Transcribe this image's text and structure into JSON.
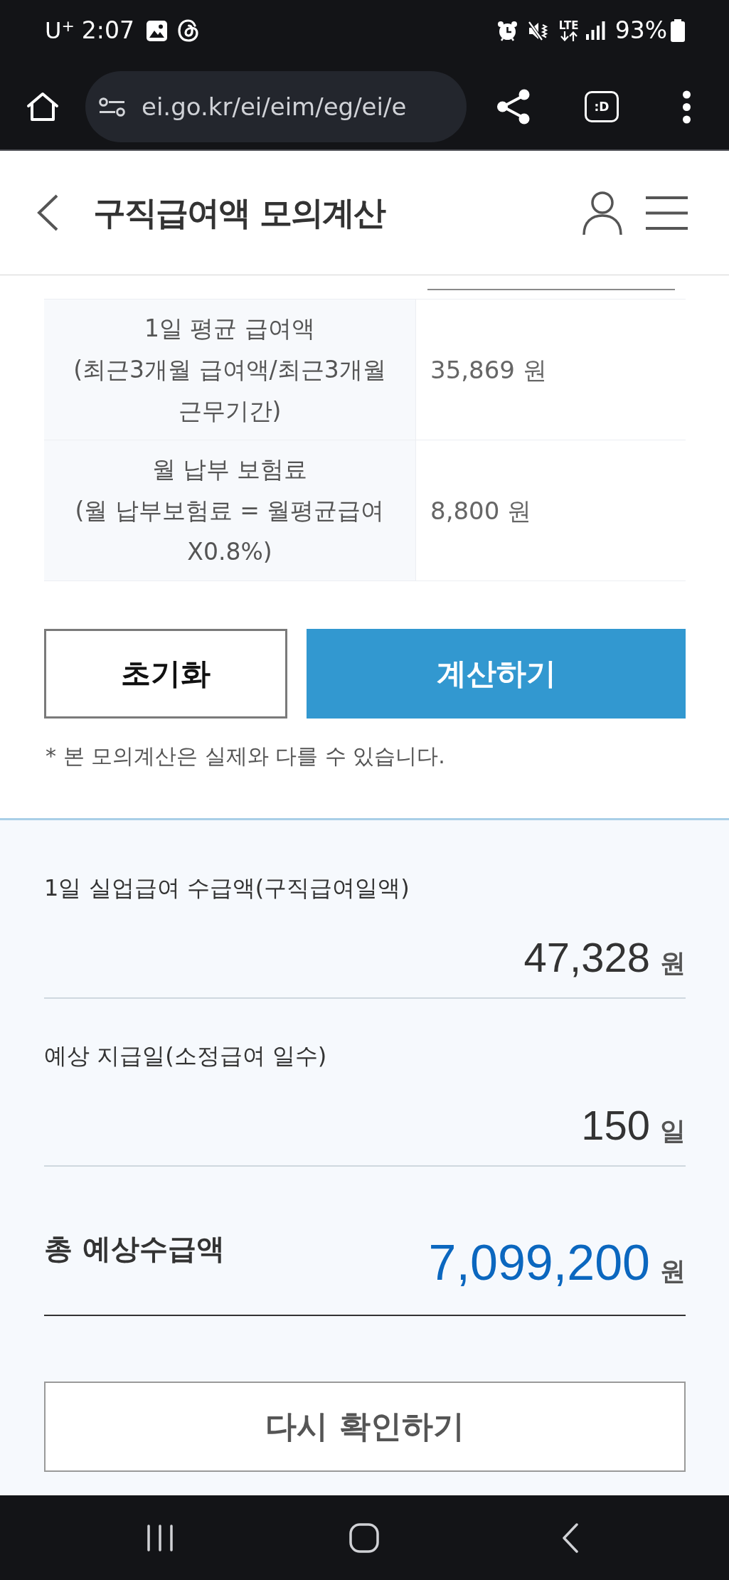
{
  "status_bar": {
    "carrier": "U$^{+}$",
    "time": "2:07",
    "network": "LTE",
    "battery": "93%"
  },
  "browser": {
    "url": "ei.go.kr/ei/eim/eg/ei/e",
    "tabs_button": ":D"
  },
  "header": {
    "title": "구직급여액 모의계산"
  },
  "form_rows": [
    {
      "label": "1일 평균 급여액",
      "note": "(최근3개월 급여액/최근3개월 근무기간)",
      "value": "35,869 원"
    },
    {
      "label": "월 납부 보험료",
      "note": "(월 납부보험료 = 월평균급여 X0.8%)",
      "value": "8,800 원"
    }
  ],
  "buttons": [
    {
      "label": "초기화",
      "kind": "outline"
    },
    {
      "label": "계산하기",
      "kind": "primary"
    }
  ],
  "disclaimer": "* 본 모의계산은 실제와 다를 수 있습니다.",
  "results": [
    {
      "kind": "item",
      "label": "1일 실업급여 수급액(구직급여일액)",
      "amount": "47,328",
      "unit": "원"
    },
    {
      "kind": "item",
      "label": "예상 지급일(소정급여 일수)",
      "amount": "150",
      "unit": "일"
    },
    {
      "kind": "total",
      "label": "총 예상수급액",
      "amount": "7,099,200",
      "unit": "원"
    }
  ],
  "recheck_button": "다시 확인하기"
}
